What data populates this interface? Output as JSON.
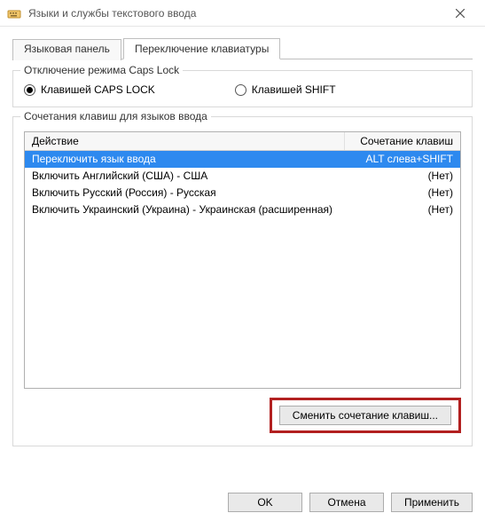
{
  "window": {
    "title": "Языки и службы текстового ввода"
  },
  "tabs": {
    "lang_panel": "Языковая панель",
    "switch_kbd": "Переключение клавиатуры"
  },
  "caps_group": {
    "legend": "Отключение режима Caps Lock",
    "opt_caps": "Клавишей CAPS LOCK",
    "opt_shift": "Клавишей SHIFT"
  },
  "hotkeys_group": {
    "legend": "Сочетания клавиш для языков ввода",
    "header_action": "Действие",
    "header_shortcut": "Сочетание клавиш",
    "rows": [
      {
        "action": "Переключить язык ввода",
        "shortcut": "ALT слева+SHIFT",
        "selected": true
      },
      {
        "action": "Включить Английский (США) - США",
        "shortcut": "(Нет)",
        "selected": false
      },
      {
        "action": "Включить Русский (Россия) - Русская",
        "shortcut": "(Нет)",
        "selected": false
      },
      {
        "action": "Включить Украинский (Украина) - Украинская (расширенная)",
        "shortcut": "(Нет)",
        "selected": false
      }
    ],
    "change_btn": "Сменить сочетание клавиш..."
  },
  "footer": {
    "ok": "OK",
    "cancel": "Отмена",
    "apply": "Применить"
  }
}
